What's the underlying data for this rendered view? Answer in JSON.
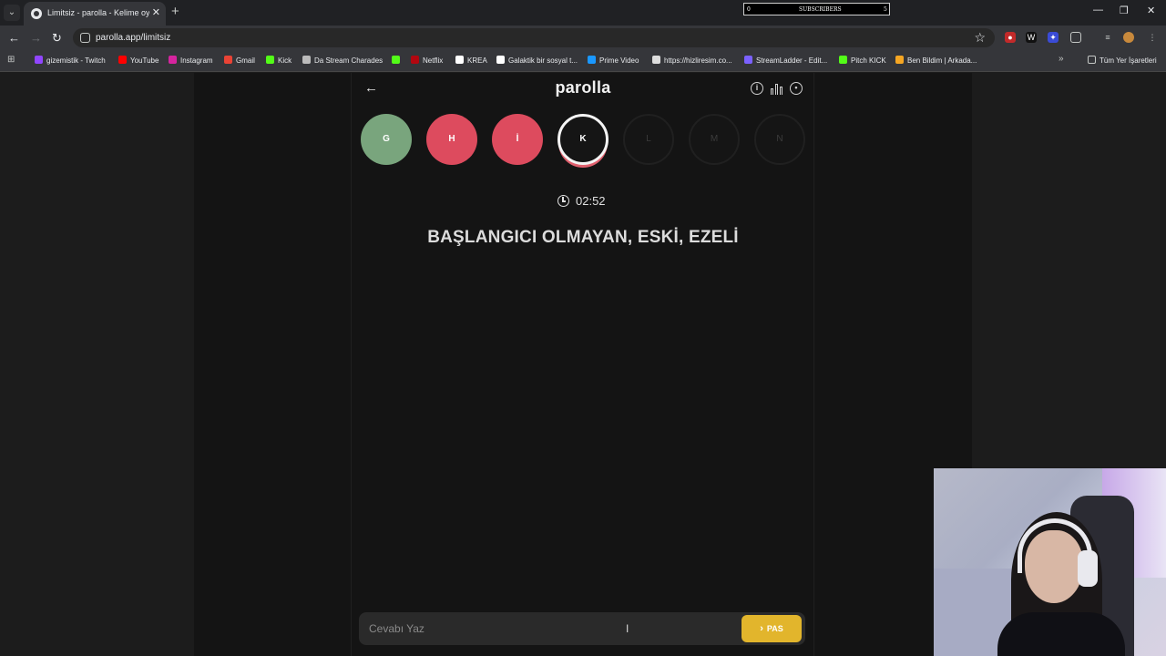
{
  "browser": {
    "tab_title": "Limitsiz - parolla - Kelime oyunu",
    "new_tab": "+",
    "url": "parolla.app/limitsiz",
    "overlay": {
      "count_left": "0",
      "label": "SUBSCRIBERS",
      "count_right": "5"
    },
    "bookmarks": [
      {
        "label": "gizemistik - Twitch",
        "color": "#9146ff"
      },
      {
        "label": "YouTube",
        "color": "#ff0000"
      },
      {
        "label": "Instagram",
        "color": "#d6249f"
      },
      {
        "label": "Gmail",
        "color": "#ea4335"
      },
      {
        "label": "Kick",
        "color": "#53fc18"
      },
      {
        "label": "Da Stream Charades",
        "color": "#bbbbbb"
      },
      {
        "label": "",
        "color": "#53fc18"
      },
      {
        "label": "Netflix",
        "color": "#b20710"
      },
      {
        "label": "KREA",
        "color": "#ffffff"
      },
      {
        "label": "Galaktik bir sosyal t...",
        "color": "#ffffff"
      },
      {
        "label": "Prime Video",
        "color": "#1a98ff"
      },
      {
        "label": "https://hizliresim.co...",
        "color": "#dddddd"
      },
      {
        "label": "StreamLadder - Edit...",
        "color": "#7b61ff"
      },
      {
        "label": "Pitch KICK",
        "color": "#53fc18"
      },
      {
        "label": "Ben Bildim | Arkada...",
        "color": "#f5a623"
      }
    ],
    "all_bookmarks": "Tüm Yer İşaretleri"
  },
  "game": {
    "brand": "parolla",
    "letters": [
      {
        "letter": "G",
        "state": "correct"
      },
      {
        "letter": "H",
        "state": "wrong"
      },
      {
        "letter": "İ",
        "state": "wrong"
      },
      {
        "letter": "K",
        "state": "active"
      },
      {
        "letter": "L",
        "state": "pending"
      },
      {
        "letter": "M",
        "state": "pending"
      },
      {
        "letter": "N",
        "state": "pending"
      }
    ],
    "timer": "02:52",
    "question": "BAŞLANGICI OLMAYAN, ESKİ, EZELİ",
    "answer_placeholder": "Cevabı Yaz",
    "pass_label": "PAS"
  },
  "colors": {
    "correct": "#79a57d",
    "wrong": "#dd4b5e",
    "pass_button": "#e2b52c",
    "background": "#141414"
  }
}
